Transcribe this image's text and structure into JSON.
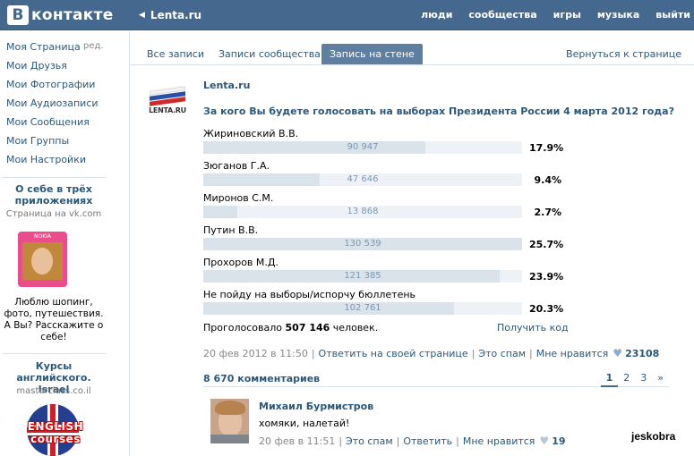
{
  "header": {
    "logo_mark": "В",
    "logo_text": "контакте",
    "crumb": "Lenta.ru",
    "nav": [
      "люди",
      "сообщества",
      "игры",
      "музыка",
      "выйти"
    ]
  },
  "sidebar": {
    "items": [
      "Моя Страница",
      "Мои Друзья",
      "Мои Фотографии",
      "Мои Аудиозаписи",
      "Мои Сообщения",
      "Мои Группы",
      "Мои Настройки"
    ],
    "edit": "ред.",
    "ad1": {
      "title": "О себе в трёх приложениях",
      "sub": "Страница на vk.com",
      "brand": "NOKIA",
      "text": "Люблю шопинг, фото, путешествия. А Вы? Расскажите о себе!"
    },
    "ad2": {
      "title": "Курсы английского. Israel",
      "sub": "masterclass.co.il",
      "image_text": "ENGLISH courses"
    }
  },
  "tabs": {
    "all": "Все записи",
    "community": "Записи сообщества",
    "wall": "Запись на стене",
    "back": "Вернуться к странице"
  },
  "post": {
    "avatar_text": "LENTA.RU",
    "author": "Lenta.ru",
    "question": "За кого Вы будете голосовать на выборах Президента России 4 марта 2012 года?",
    "options": [
      {
        "label": "Жириновский В.В.",
        "votes": "90 947",
        "percent": "17.9%",
        "fill": 0.697
      },
      {
        "label": "Зюганов Г.А.",
        "votes": "47 646",
        "percent": "9.4%",
        "fill": 0.365
      },
      {
        "label": "Миронов С.М.",
        "votes": "13 868",
        "percent": "2.7%",
        "fill": 0.106
      },
      {
        "label": "Путин В.В.",
        "votes": "130 539",
        "percent": "25.7%",
        "fill": 1.0
      },
      {
        "label": "Прохоров М.Д.",
        "votes": "121 385",
        "percent": "23.9%",
        "fill": 0.93
      },
      {
        "label": "Не пойду на выборы/испорчу бюллетень",
        "votes": "102 761",
        "percent": "20.3%",
        "fill": 0.787
      }
    ],
    "total_prefix": "Проголосовало",
    "total_count": "507 146",
    "total_suffix": "человек.",
    "get_code": "Получить код",
    "date": "20 фев 2012 в 11:50",
    "reply": "Ответить на своей странице",
    "spam": "Это спам",
    "like": "Мне нравится",
    "like_count": "23108"
  },
  "comments": {
    "count": "8 670 комментариев",
    "pages": [
      "1",
      "2",
      "3",
      "»"
    ],
    "items": [
      {
        "author": "Михаил Бурмистров",
        "text": "хомяки, налетай!",
        "date": "20 фев в 11:51",
        "spam": "Это спам",
        "reply": "Ответить",
        "like": "Мне нравится",
        "like_count": "19"
      }
    ]
  },
  "watermark": "jeskobra",
  "colors": {
    "header": "#45688e",
    "link": "#2b587a",
    "active_tab": "#5f7fa0",
    "bar_fill": "#dae2ea",
    "bar_track": "#eef2f6"
  }
}
